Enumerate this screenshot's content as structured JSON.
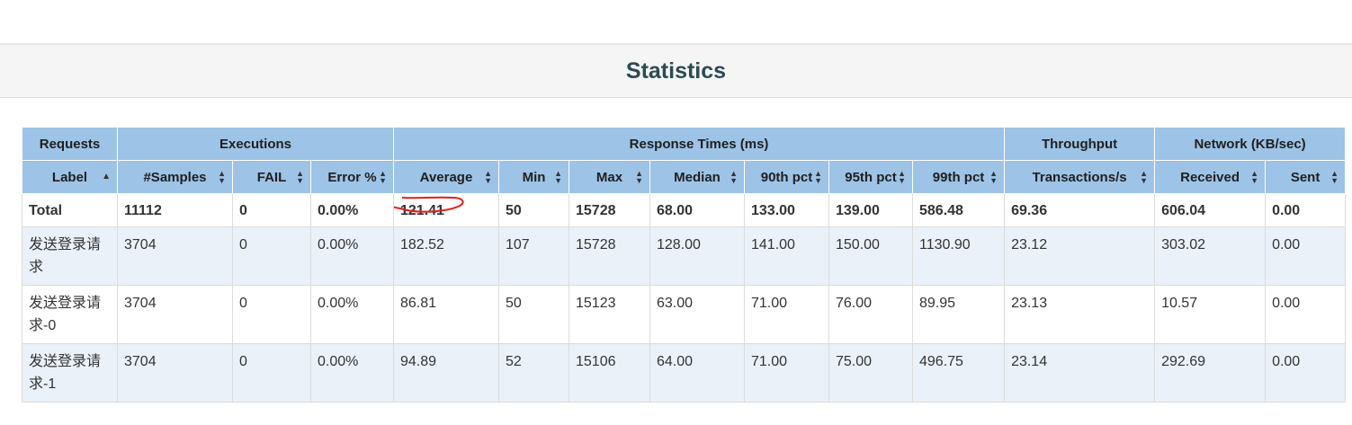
{
  "panel": {
    "title": "Statistics"
  },
  "groups": [
    {
      "label": "Requests",
      "span": 1
    },
    {
      "label": "Executions",
      "span": 3
    },
    {
      "label": "Response Times (ms)",
      "span": 7
    },
    {
      "label": "Throughput",
      "span": 1
    },
    {
      "label": "Network (KB/sec)",
      "span": 2
    }
  ],
  "columns": [
    {
      "label": "Label",
      "sort": "asc"
    },
    {
      "label": "#Samples",
      "sort": "both"
    },
    {
      "label": "FAIL",
      "sort": "both"
    },
    {
      "label": "Error %",
      "sort": "both"
    },
    {
      "label": "Average",
      "sort": "both"
    },
    {
      "label": "Min",
      "sort": "both"
    },
    {
      "label": "Max",
      "sort": "both"
    },
    {
      "label": "Median",
      "sort": "both"
    },
    {
      "label": "90th pct",
      "sort": "both"
    },
    {
      "label": "95th pct",
      "sort": "both"
    },
    {
      "label": "99th pct",
      "sort": "both"
    },
    {
      "label": "Transactions/s",
      "sort": "both"
    },
    {
      "label": "Received",
      "sort": "both"
    },
    {
      "label": "Sent",
      "sort": "both"
    }
  ],
  "total": [
    "Total",
    "11112",
    "0",
    "0.00%",
    "121.41",
    "50",
    "15728",
    "68.00",
    "133.00",
    "139.00",
    "586.48",
    "69.36",
    "606.04",
    "0.00"
  ],
  "rows": [
    [
      "发送登录请求",
      "3704",
      "0",
      "0.00%",
      "182.52",
      "107",
      "15728",
      "128.00",
      "141.00",
      "150.00",
      "1130.90",
      "23.12",
      "303.02",
      "0.00"
    ],
    [
      "发送登录请求-0",
      "3704",
      "0",
      "0.00%",
      "86.81",
      "50",
      "15123",
      "63.00",
      "71.00",
      "76.00",
      "89.95",
      "23.13",
      "10.57",
      "0.00"
    ],
    [
      "发送登录请求-1",
      "3704",
      "0",
      "0.00%",
      "94.89",
      "52",
      "15106",
      "64.00",
      "71.00",
      "75.00",
      "496.75",
      "23.14",
      "292.69",
      "0.00"
    ]
  ],
  "annotation": {
    "target": "total.average",
    "color": "#e0201b"
  }
}
